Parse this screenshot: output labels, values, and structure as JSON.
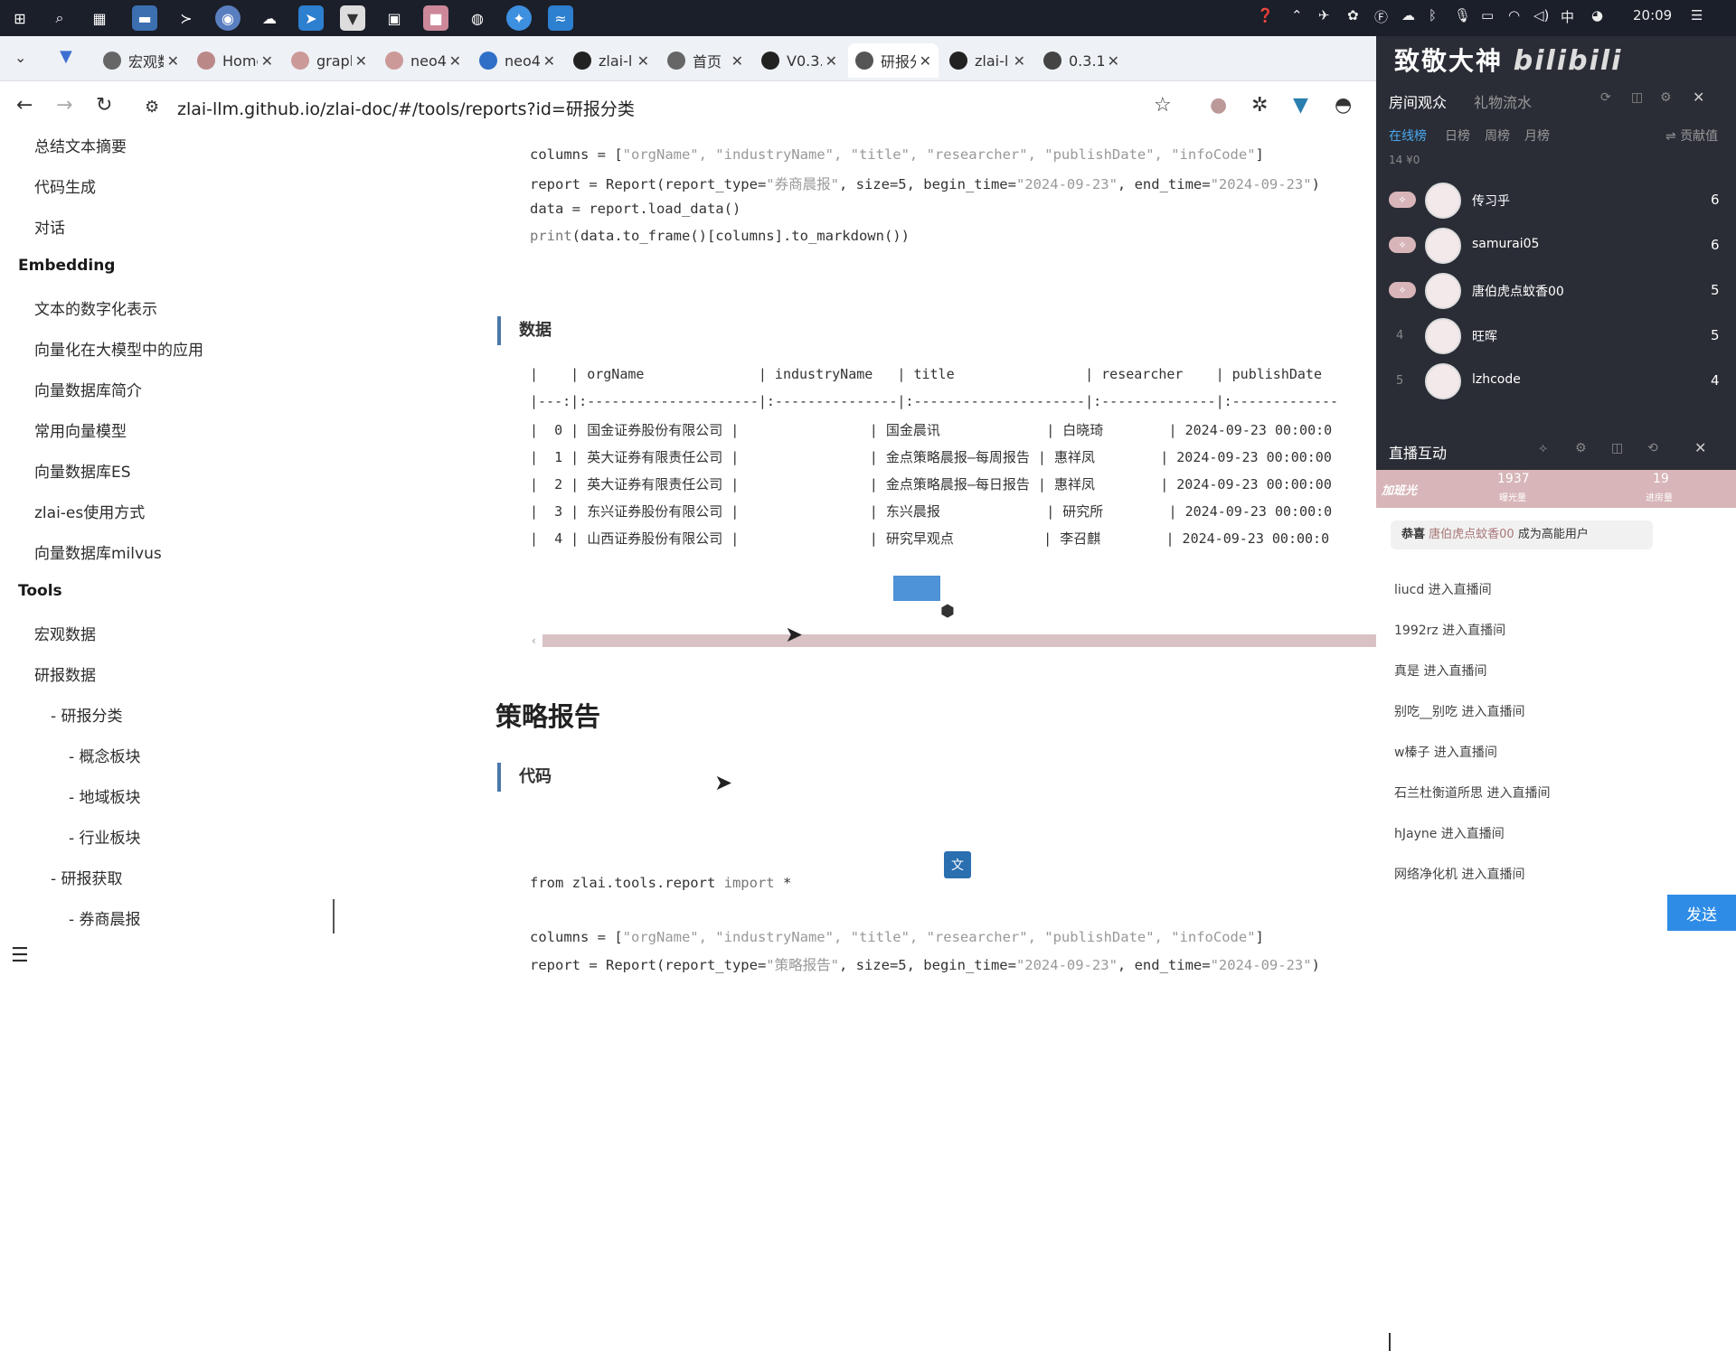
{
  "taskbar": {
    "time": "20:09",
    "ime": "中"
  },
  "tabs": [
    {
      "label": "宏观数",
      "fav": "#666"
    },
    {
      "label": "Home",
      "fav": "#b88"
    },
    {
      "label": "graph",
      "fav": "#c99"
    },
    {
      "label": "neo4j",
      "fav": "#c99"
    },
    {
      "label": "neo4",
      "fav": "#2f6fc7"
    },
    {
      "label": "zlai-l",
      "fav": "#222"
    },
    {
      "label": "首页",
      "fav": "#666"
    },
    {
      "label": "V0.3.",
      "fav": "#222"
    },
    {
      "label": "研报分",
      "fav": "#555"
    },
    {
      "label": "zlai-l",
      "fav": "#222"
    },
    {
      "label": "0.3.1",
      "fav": "#444"
    }
  ],
  "address": {
    "url": "zlai-llm.github.io/zlai-doc/#/tools/reports?id=研报分类"
  },
  "sidebar": {
    "items": [
      "总结文本摘要",
      "代码生成",
      "对话"
    ],
    "embedding_title": "Embedding",
    "embedding_items": [
      "文本的数字化表示",
      "向量化在大模型中的应用",
      "向量数据库简介",
      "常用向量模型",
      "向量数据库ES",
      "zlai-es使用方式",
      "向量数据库milvus"
    ],
    "tools_title": "Tools",
    "tools_items": [
      "宏观数据",
      "研报数据"
    ],
    "sub1": "- 研报分类",
    "sub2": [
      "- 概念板块",
      "- 地域板块",
      "- 行业板块"
    ],
    "sub3": "- 研报获取",
    "sub4": "- 券商晨报"
  },
  "content": {
    "code1": {
      "l1a": "columns = [",
      "l1s": "\"orgName\", \"industryName\", \"title\", \"researcher\", \"publishDate\", \"infoCode\"",
      "l1b": "]",
      "l2a": "report = Report(report_type=",
      "l2s1": "\"券商晨报\"",
      "l2b": ", size=5, begin_time=",
      "l2s2": "\"2024-09-23\"",
      "l2c": ", end_time=",
      "l2s3": "\"2024-09-23\"",
      "l2d": ")",
      "l3": "data = report.load_data()",
      "l4k": "print",
      "l4": "(data.to_frame()[columns].to_markdown())"
    },
    "data_heading": "数据",
    "table_lines": [
      "|    | orgName              | industryName   | title                | researcher    | publishDate",
      "|---:|:---------------------|:---------------|:---------------------|:--------------|:-------------",
      "|  0 | 国金证券股份有限公司 |                | 国金晨讯             | 白晓琦        | 2024-09-23 00:00:0",
      "|  1 | 英大证券有限责任公司 |                | 金点策略晨报—每周报告 | 惠祥凤        | 2024-09-23 00:00:00",
      "|  2 | 英大证券有限责任公司 |                | 金点策略晨报—每日报告 | 惠祥凤        | 2024-09-23 00:00:00",
      "|  3 | 东兴证券股份有限公司 |                | 东兴晨报             | 研究所        | 2024-09-23 00:00:0",
      "|  4 | 山西证券股份有限公司 |                | 研究早观点           | 李召麒        | 2024-09-23 00:00:0"
    ],
    "strategy_title": "策略报告",
    "code_heading": "代码",
    "code2": {
      "l1a": "from zlai.tools.report ",
      "l1k": "import",
      "l1b": " *",
      "l2a": "columns = [",
      "l2s": "\"orgName\", \"industryName\", \"title\", \"researcher\", \"publishDate\", \"infoCode\"",
      "l2b": "]",
      "l3a": "report = Report(report_type=",
      "l3s1": "\"策略报告\"",
      "l3b": ", size=5, begin_time=",
      "l3s2": "\"2024-09-23\"",
      "l3c": ", end_time=",
      "l3s3": "\"2024-09-23\"",
      "l3d": ")"
    }
  },
  "live": {
    "banner": "致敬大神",
    "tab_audience": "房间观众",
    "tab_gifts": "礼物流水",
    "rank_tabs": [
      "在线榜",
      "日榜",
      "周榜",
      "月榜"
    ],
    "contrib": "贡献值",
    "stats": "14  ¥0",
    "users": [
      {
        "name": "传习乎",
        "score": "6",
        "rank": ""
      },
      {
        "name": "samurai05",
        "score": "6",
        "rank": ""
      },
      {
        "name": "唐伯虎点蚊香00",
        "score": "5",
        "rank": ""
      },
      {
        "name": "旺晖",
        "score": "5",
        "rank": "4"
      },
      {
        "name": "lzhcode",
        "score": "4",
        "rank": "5"
      }
    ],
    "interact_title": "直播互动",
    "fans": "加班光",
    "count1": "1937",
    "count1_label": "曝光量",
    "count2": "19",
    "count2_label": "进房量",
    "congrats": "恭喜",
    "congrats_user": "唐伯虎点蚊香00",
    "congrats_text": "成为高能用户",
    "entries": [
      "liucd 进入直播间",
      "1992rz 进入直播间",
      "真是 进入直播间",
      "别吃__别吃 进入直播间",
      "w榛子 进入直播间",
      "石兰杜衡道所思 进入直播间",
      "hJayne 进入直播间",
      "网络净化机 进入直播间"
    ],
    "send": "发送"
  }
}
